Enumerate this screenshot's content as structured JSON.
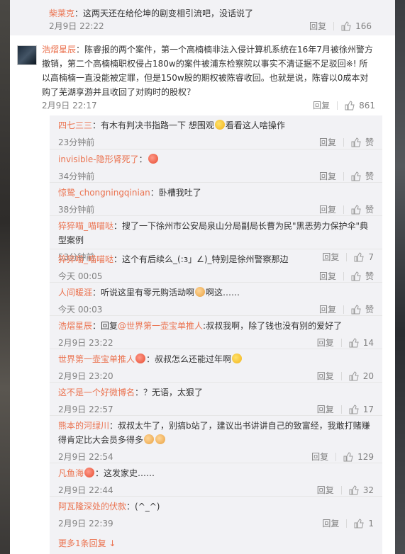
{
  "top": {
    "user": "柴莱克",
    "text": "：这两天还在给伦坤的剧变相引流吧，没话说了",
    "time": "2月9日 22:22",
    "reply": "回复",
    "likes": "166"
  },
  "main": {
    "user": "浩熠星辰",
    "text": "：陈睿报的两个案件，第一个高楠楠非法入侵计算机系统在16年7月被徐州警方撤销，第二个高楠楠职权侵占180w的案件被浦东检察院以事实不清证据不足驳回※! 所以高楠楠一直没能被定罪，但是150w股的期权被陈睿收回。也就是说，陈睿以0成本对购了芜湖享游并且收回了对购时的股权？",
    "time": "2月9日 22:17",
    "reply": "回复",
    "likes": "861"
  },
  "replies": [
    {
      "user": "四七三三",
      "text_before": "：有木有判决书指路一下 想围观",
      "emoji": "y",
      "text_after": "看看这人啥操作",
      "time": "23分钟前",
      "reply": "回复",
      "likes": "赞"
    },
    {
      "user": "invisible-隐形肾死了",
      "text_before": "：",
      "emoji": "r",
      "text_after": "",
      "time": "34分钟前",
      "reply": "回复",
      "likes": "赞"
    },
    {
      "user": "惊鸷_chongningqinian",
      "text_before": "：卧槽我吐了",
      "emoji": "",
      "text_after": "",
      "time": "38分钟前",
      "reply": "回复",
      "likes": "赞"
    },
    {
      "user": "猝猝喵_喵喵哒",
      "text_before": "：搜了一下徐州市公安局泉山分局副局长曹为民\"黑恶势力保护伞\"典型案例",
      "emoji": "",
      "text_after": "",
      "time": "53分钟前",
      "reply": "回复",
      "likes": "7"
    },
    {
      "user": "猝猝喵_喵喵哒",
      "text_before": "：这个有后续么_(:з」∠)_特别是徐州警察那边",
      "emoji": "",
      "text_after": "",
      "time": "今天 00:05",
      "reply": "回复",
      "likes": "赞"
    },
    {
      "user": "人间暖涯",
      "text_before": "：听说这里有零元购活动啊",
      "emoji": "b",
      "text_after": "啊这……",
      "time": "今天 00:03",
      "reply": "回复",
      "likes": "赞"
    },
    {
      "user": "浩熠星辰",
      "text_before": "：回复",
      "reply_to": "@世界第一壶宝单推人",
      "text_after": ":叔叔我啊，除了钱也没有别的爱好了",
      "emoji": "",
      "time": "2月9日 23:22",
      "reply": "回复",
      "likes": "14"
    },
    {
      "user": "世界第一壶宝单推人",
      "user_emoji": "r",
      "text_before": "：叔叔怎么还能过年啊",
      "emoji": "y",
      "text_after": "",
      "time": "2月9日 23:20",
      "reply": "回复",
      "likes": "20"
    },
    {
      "user": "这不是一个好微博名",
      "text_before": "：？无语，太狠了",
      "emoji": "",
      "text_after": "",
      "time": "2月9日 22:57",
      "reply": "回复",
      "likes": "17"
    },
    {
      "user": "熊本的河绿川",
      "text_before": "：叔叔太牛了，别搞b站了，建议出书讲讲自己的致富经，我敢打赌赚得肯定比大会员多得多",
      "emoji": "b",
      "text_after": "",
      "time": "2月9日 22:54",
      "reply": "回复",
      "likes": "129"
    },
    {
      "user": "凡鱼海",
      "user_emoji": "r",
      "text_before": "：这发家史……",
      "emoji": "",
      "text_after": "",
      "time": "2月9日 22:44",
      "reply": "回复",
      "likes": "32"
    },
    {
      "user": "阿瓦隆深处的伏款",
      "text_before": "：(^_^)",
      "emoji": "",
      "text_after": "",
      "time": "2月9日 22:39",
      "reply": "回复",
      "likes": "1"
    }
  ],
  "more_label": "更多1条回复",
  "more_arrow": "↓",
  "colors": {
    "accent": "#eb7350",
    "reply_bg": "#f2f2f5",
    "meta": "#808080"
  }
}
